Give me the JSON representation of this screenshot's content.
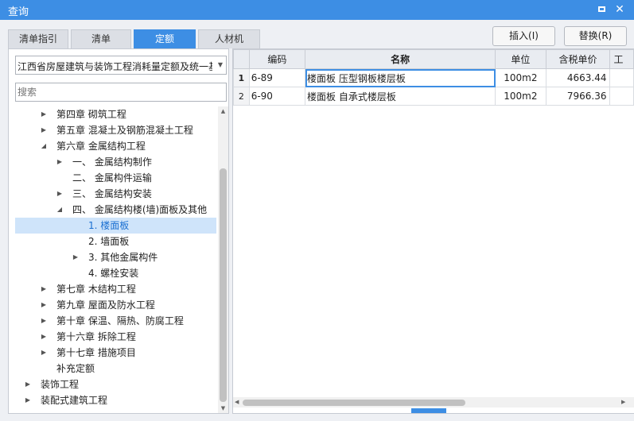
{
  "window": {
    "title": "查询"
  },
  "tabs": [
    "清单指引",
    "清单",
    "定额",
    "人材机"
  ],
  "active_tab": "定额",
  "buttons": {
    "insert": "插入(I)",
    "replace": "替换(R)"
  },
  "library": {
    "selected": "江西省房屋建筑与装饰工程消耗量定额及统一基价表"
  },
  "search": {
    "placeholder": "搜索"
  },
  "tree": [
    {
      "label": "第四章 砌筑工程",
      "level": 1,
      "expander": "collapsed"
    },
    {
      "label": "第五章 混凝土及钢筋混凝土工程",
      "level": 1,
      "expander": "collapsed"
    },
    {
      "label": "第六章 金属结构工程",
      "level": 1,
      "expander": "expanded"
    },
    {
      "label": "一、  金属结构制作",
      "level": 2,
      "expander": "collapsed"
    },
    {
      "label": "二、  金属构件运输",
      "level": 2,
      "expander": "none"
    },
    {
      "label": "三、  金属结构安装",
      "level": 2,
      "expander": "collapsed"
    },
    {
      "label": "四、  金属结构楼(墙)面板及其他",
      "level": 2,
      "expander": "expanded"
    },
    {
      "label": "1. 楼面板",
      "level": 3,
      "expander": "none",
      "selected": true
    },
    {
      "label": "2. 墙面板",
      "level": 3,
      "expander": "none"
    },
    {
      "label": "3. 其他金属构件",
      "level": 3,
      "expander": "collapsed"
    },
    {
      "label": "4. 螺栓安装",
      "level": 3,
      "expander": "none"
    },
    {
      "label": "第七章 木结构工程",
      "level": 1,
      "expander": "collapsed"
    },
    {
      "label": "第九章 屋面及防水工程",
      "level": 1,
      "expander": "collapsed"
    },
    {
      "label": "第十章 保温、隔热、防腐工程",
      "level": 1,
      "expander": "collapsed"
    },
    {
      "label": "第十六章 拆除工程",
      "level": 1,
      "expander": "collapsed"
    },
    {
      "label": "第十七章 措施项目",
      "level": 1,
      "expander": "collapsed"
    },
    {
      "label": "补充定额",
      "level": 1,
      "expander": "none"
    },
    {
      "label": "装饰工程",
      "level": 0,
      "expander": "collapsed"
    },
    {
      "label": "装配式建筑工程",
      "level": 0,
      "expander": "collapsed"
    }
  ],
  "table": {
    "columns": [
      "",
      "编码",
      "名称",
      "单位",
      "含税单价",
      "工"
    ],
    "rows": [
      {
        "no": "1",
        "code": "6-89",
        "name": "楼面板 压型钢板楼层板",
        "unit": "100m2",
        "price": "4663.44"
      },
      {
        "no": "2",
        "code": "6-90",
        "name": "楼面板 自承式楼层板",
        "unit": "100m2",
        "price": "7966.36"
      }
    ]
  },
  "colors": {
    "accent": "#3d8ee4",
    "selected_bg": "#cfe4fa",
    "selected_text": "#1a6fd1"
  }
}
